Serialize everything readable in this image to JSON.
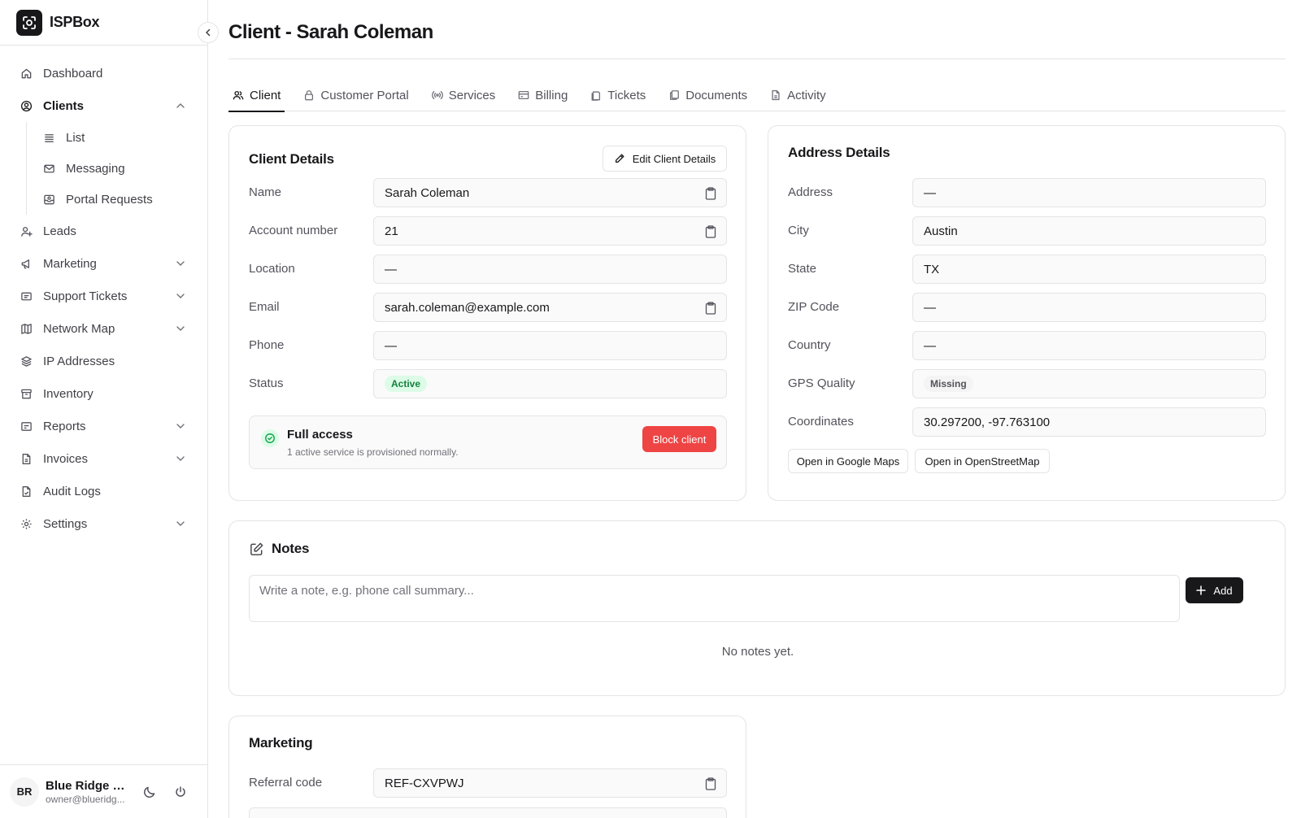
{
  "app": {
    "name": "ISPBox"
  },
  "sidebar": {
    "items": [
      {
        "label": "Dashboard",
        "icon": "home-icon"
      },
      {
        "label": "Clients",
        "icon": "user-circle-icon",
        "active": true,
        "expanded": true,
        "children": [
          {
            "label": "List",
            "icon": "list-icon"
          },
          {
            "label": "Messaging",
            "icon": "mail-icon"
          },
          {
            "label": "Portal Requests",
            "icon": "inbox-icon"
          }
        ]
      },
      {
        "label": "Leads",
        "icon": "user-plus-icon"
      },
      {
        "label": "Marketing",
        "icon": "megaphone-icon",
        "has_children": true
      },
      {
        "label": "Support Tickets",
        "icon": "ticket-icon",
        "has_children": true
      },
      {
        "label": "Network Map",
        "icon": "map-icon",
        "has_children": true
      },
      {
        "label": "IP Addresses",
        "icon": "layers-icon"
      },
      {
        "label": "Inventory",
        "icon": "archive-icon"
      },
      {
        "label": "Reports",
        "icon": "clipboard-icon",
        "has_children": true
      },
      {
        "label": "Invoices",
        "icon": "file-icon",
        "has_children": true
      },
      {
        "label": "Audit Logs",
        "icon": "file-check-icon"
      },
      {
        "label": "Settings",
        "icon": "gear-icon",
        "has_children": true
      }
    ],
    "user": {
      "initials": "BR",
      "name": "Blue Ridge O...",
      "email": "owner@blueridg..."
    }
  },
  "page": {
    "title": "Client - Sarah Coleman"
  },
  "tabs": [
    {
      "label": "Client",
      "icon": "users-icon",
      "active": true
    },
    {
      "label": "Customer Portal",
      "icon": "lock-icon"
    },
    {
      "label": "Services",
      "icon": "broadcast-icon"
    },
    {
      "label": "Billing",
      "icon": "credit-card-icon"
    },
    {
      "label": "Tickets",
      "icon": "ticket-icon"
    },
    {
      "label": "Documents",
      "icon": "copy-icon"
    },
    {
      "label": "Activity",
      "icon": "file-icon"
    }
  ],
  "client_details": {
    "title": "Client Details",
    "edit_label": "Edit Client Details",
    "fields": [
      {
        "label": "Name",
        "value": "Sarah Coleman",
        "copyable": true
      },
      {
        "label": "Account number",
        "value": "21",
        "copyable": true
      },
      {
        "label": "Location",
        "value": "—"
      },
      {
        "label": "Email",
        "value": "sarah.coleman@example.com",
        "copyable": true
      },
      {
        "label": "Phone",
        "value": "—"
      }
    ],
    "status_label": "Status",
    "status_value": "Active",
    "access": {
      "title": "Full access",
      "subtitle": "1 active service is provisioned normally.",
      "block_label": "Block client"
    }
  },
  "address_details": {
    "title": "Address Details",
    "fields": [
      {
        "label": "Address",
        "value": "—"
      },
      {
        "label": "City",
        "value": "Austin"
      },
      {
        "label": "State",
        "value": "TX"
      },
      {
        "label": "ZIP Code",
        "value": "—"
      },
      {
        "label": "Country",
        "value": "—"
      }
    ],
    "gps_label": "GPS Quality",
    "gps_value": "Missing",
    "coords_label": "Coordinates",
    "coords_value": "30.297200, -97.763100",
    "google_maps_label": "Open in Google Maps",
    "osm_label": "Open in OpenStreetMap"
  },
  "notes": {
    "title": "Notes",
    "placeholder": "Write a note, e.g. phone call summary...",
    "add_label": "Add",
    "empty": "No notes yet."
  },
  "marketing": {
    "title": "Marketing",
    "referral_label": "Referral code",
    "referral_value": "REF-CXVPWJ"
  },
  "colors": {
    "accent": "#18181b",
    "danger": "#ef4444",
    "success_bg": "#dcfce7",
    "success_text": "#15803d",
    "border": "#e4e4e7"
  }
}
